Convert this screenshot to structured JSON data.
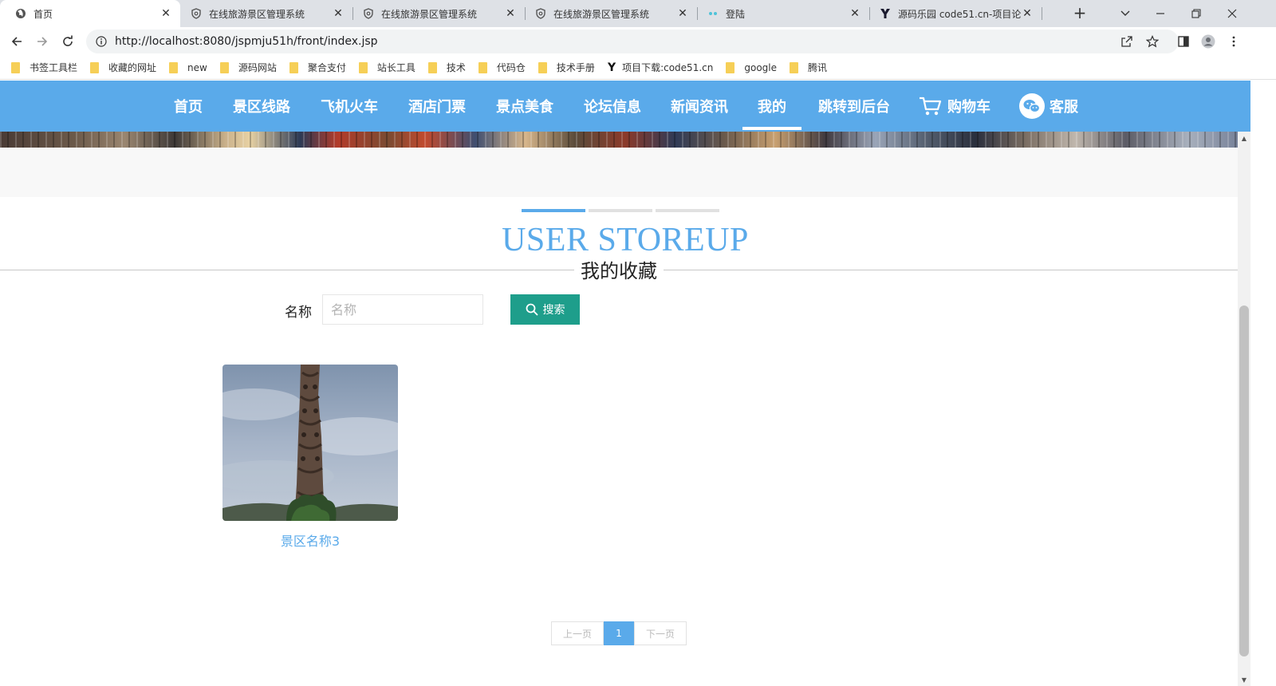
{
  "browser": {
    "tabs": [
      {
        "title": "首页",
        "icon": "globe-icon",
        "active": true
      },
      {
        "title": "在线旅游景区管理系统",
        "icon": "shield-icon"
      },
      {
        "title": "在线旅游景区管理系统",
        "icon": "shield-icon"
      },
      {
        "title": "在线旅游景区管理系统",
        "icon": "shield-icon"
      },
      {
        "title": "登陆",
        "icon": "dots-icon"
      },
      {
        "title": "源码乐园 code51.cn-项目论",
        "icon": "y-logo-icon"
      }
    ],
    "close_glyph": "✕",
    "new_tab_glyph": "+",
    "url": "http://localhost:8080/jspmju51h/front/index.jsp",
    "bookmarks": [
      {
        "label": "书签工具栏",
        "icon": "folder-icon"
      },
      {
        "label": "收藏的网址",
        "icon": "folder-icon"
      },
      {
        "label": "new",
        "icon": "folder-icon"
      },
      {
        "label": "源码网站",
        "icon": "folder-icon"
      },
      {
        "label": "聚合支付",
        "icon": "folder-icon"
      },
      {
        "label": "站长工具",
        "icon": "folder-icon"
      },
      {
        "label": "技术",
        "icon": "folder-icon"
      },
      {
        "label": "代码仓",
        "icon": "folder-icon"
      },
      {
        "label": "技术手册",
        "icon": "folder-icon"
      },
      {
        "label": "项目下载:code51.cn",
        "icon": "y-logo-icon",
        "logo": "Y"
      },
      {
        "label": "google",
        "icon": "folder-icon"
      },
      {
        "label": "腾讯",
        "icon": "folder-icon"
      }
    ]
  },
  "nav": {
    "items": [
      {
        "label": "首页"
      },
      {
        "label": "景区线路"
      },
      {
        "label": "飞机火车"
      },
      {
        "label": "酒店门票"
      },
      {
        "label": "景点美食"
      },
      {
        "label": "论坛信息"
      },
      {
        "label": "新闻资讯"
      },
      {
        "label": "我的",
        "active": true
      },
      {
        "label": "跳转到后台"
      },
      {
        "label": "购物车",
        "icon": "cart-icon"
      },
      {
        "label": "客服",
        "icon": "wechat-icon"
      }
    ]
  },
  "section": {
    "title": "USER STOREUP",
    "subtitle": "我的收藏"
  },
  "search": {
    "label": "名称",
    "placeholder": "名称",
    "value": "",
    "button_label": "搜索"
  },
  "favorites": [
    {
      "name": "景区名称3"
    }
  ],
  "pagination": {
    "prev": "上一页",
    "current": "1",
    "next": "下一页"
  },
  "colors": {
    "primary": "#5aaaea",
    "search_button": "#1e9e8b"
  }
}
